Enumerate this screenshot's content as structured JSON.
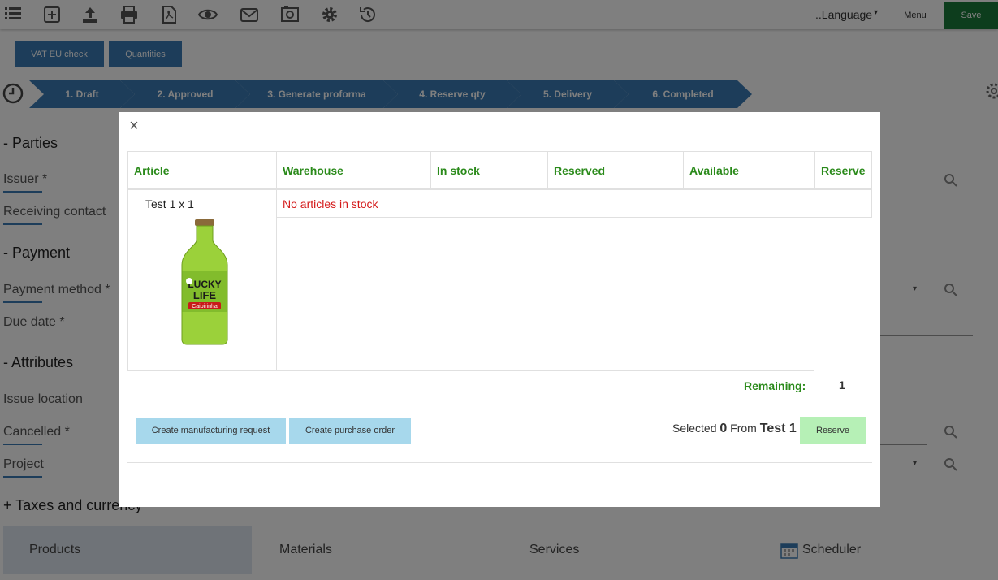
{
  "toolbar": {
    "icons": [
      "list-icon",
      "add-icon",
      "upload-icon",
      "print-icon",
      "pdf-icon",
      "preview-icon",
      "email-icon",
      "camera-icon",
      "settings-icon",
      "history-icon"
    ],
    "language_label": "..Language",
    "menu_label": "Menu",
    "save_label": "Save"
  },
  "actions": {
    "vat_label": "VAT EU check",
    "quantities_label": "Quantities"
  },
  "workflow": {
    "steps": [
      "1. Draft",
      "2. Approved",
      "3. Generate proforma",
      "4. Reserve qty",
      "5. Delivery",
      "6. Completed"
    ]
  },
  "form": {
    "parties_title": "- Parties",
    "issuer_label": "Issuer *",
    "receiving_contact_label": "Receiving contact",
    "payment_title": "- Payment",
    "payment_method_label": "Payment method *",
    "due_date_label": "Due date *",
    "attributes_title": "- Attributes",
    "issue_location_label": "Issue location",
    "cancelled_label": "Cancelled *",
    "project_label": "Project",
    "taxes_title": "+ Taxes and currency"
  },
  "tabs": [
    "Products",
    "Materials",
    "Services",
    "Scheduler"
  ],
  "modal": {
    "close_label": "×",
    "columns": [
      "Article",
      "Warehouse",
      "In stock",
      "Reserved",
      "Available",
      "Reserve"
    ],
    "article_name": "Test 1 x 1",
    "product_image_text": [
      "LUCKY",
      "LIFE",
      "Caipirinha"
    ],
    "no_stock_message": "No articles in stock",
    "remaining_label": "Remaining:",
    "remaining_value": "1",
    "create_manufacturing_label": "Create manufacturing request",
    "create_purchase_label": "Create purchase order",
    "selected_prefix": "Selected",
    "selected_count": "0",
    "from_label": "From",
    "from_article": "Test 1",
    "reserve_button_label": "Reserve"
  },
  "colors": {
    "accent_blue": "#3a7ab4",
    "header_green": "#2a8a1a",
    "error_red": "#d41a1a",
    "save_green": "#1a7a3a",
    "reserve_green": "#b6f0b6",
    "button_light_blue": "#a7d8ec"
  }
}
